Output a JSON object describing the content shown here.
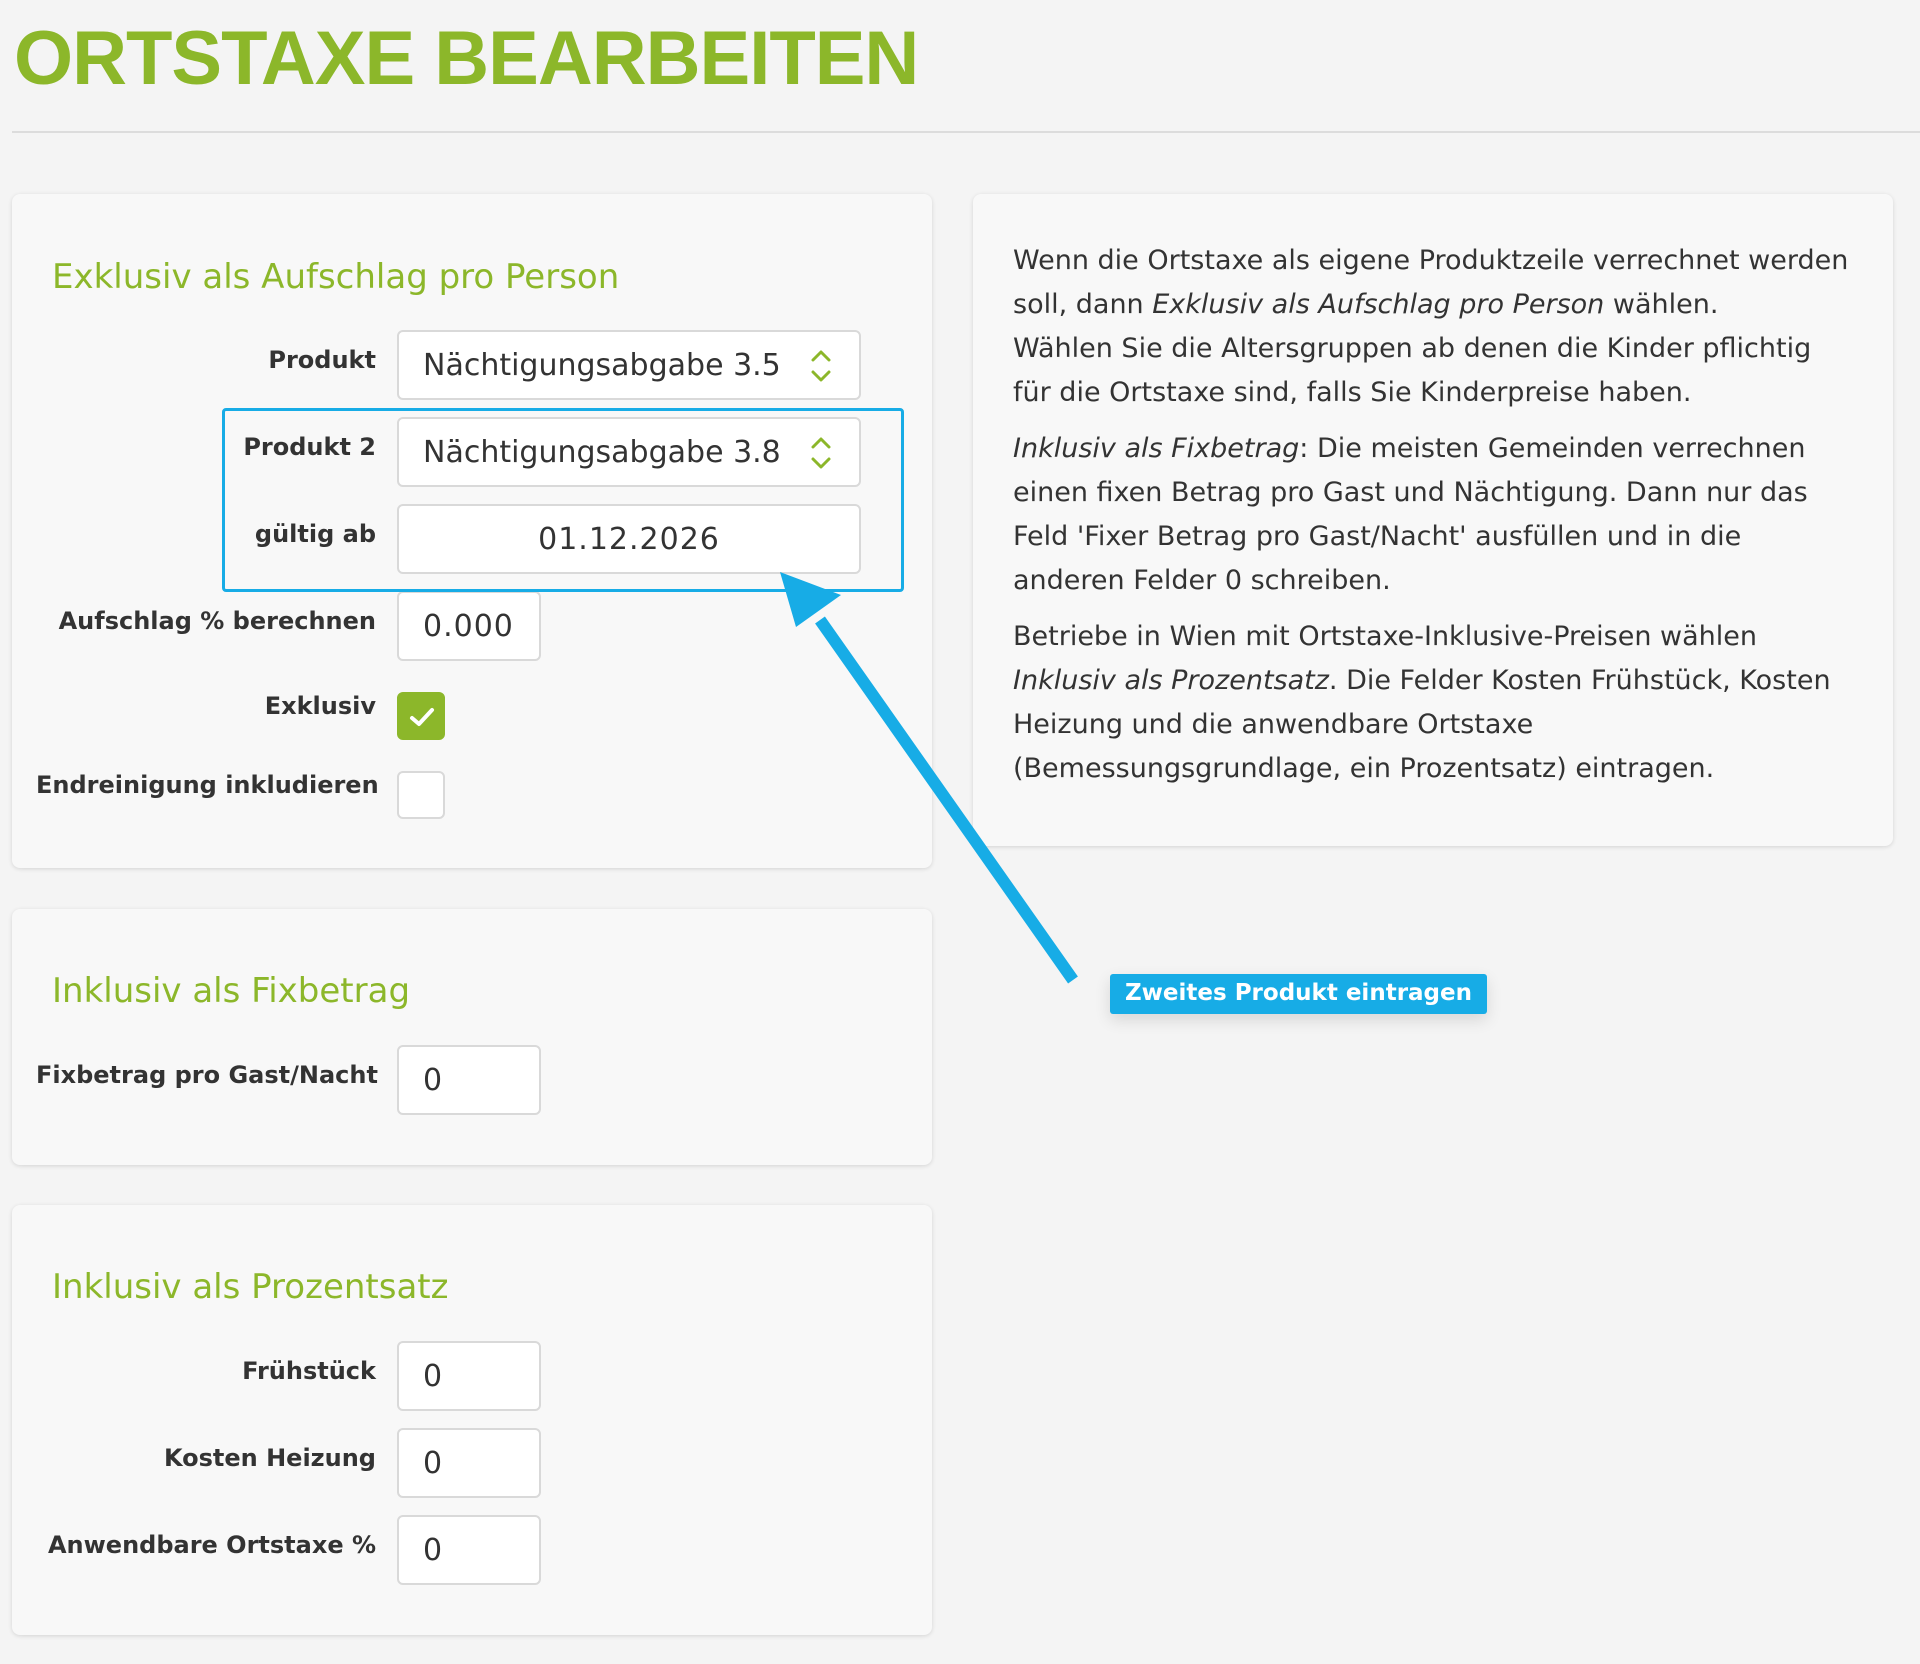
{
  "page": {
    "title": "ORTSTAXE BEARBEITEN"
  },
  "colors": {
    "accent": "#8cb72a",
    "highlight": "#17ace6"
  },
  "exklusiv": {
    "title": "Exklusiv als Aufschlag pro Person",
    "produkt": {
      "label": "Produkt",
      "value": "Nächtigungsabgabe 3.5"
    },
    "produkt2": {
      "label": "Produkt 2",
      "value": "Nächtigungsabgabe 3.8"
    },
    "gueltig_ab": {
      "label": "gültig ab",
      "value": "01.12.2026"
    },
    "aufschlag": {
      "label": "Aufschlag % berechnen",
      "value": "0.000"
    },
    "exklusiv_check": {
      "label": "Exklusiv",
      "checked": true
    },
    "endreinigung": {
      "label": "Endreinigung inkludieren",
      "checked": false
    }
  },
  "fixbetrag": {
    "title": "Inklusiv als Fixbetrag",
    "fix": {
      "label": "Fixbetrag pro Gast/Nacht",
      "value": "0"
    }
  },
  "prozentsatz": {
    "title": "Inklusiv als Prozentsatz",
    "fruehstueck": {
      "label": "Frühstück",
      "value": "0"
    },
    "heizung": {
      "label": "Kosten Heizung",
      "value": "0"
    },
    "ortstaxe": {
      "label": "Anwendbare Ortstaxe %",
      "value": "0"
    }
  },
  "info": {
    "p1a": "Wenn die Ortstaxe als eigene Produktzeile verrechnet werden soll, dann ",
    "p1b": "Exklusiv als Aufschlag pro Person",
    "p1c": " wählen.",
    "p1d": "Wählen Sie die Altersgruppen ab denen die Kinder pflichtig für die Ortstaxe sind, falls Sie Kinderpreise haben.",
    "p2a": "Inklusiv als Fixbetrag",
    "p2b": ": Die meisten Gemeinden verrechnen einen fixen Betrag pro Gast und Nächtigung. Dann nur das Feld 'Fixer Betrag pro Gast/Nacht' ausfüllen und in die anderen Felder 0 schreiben.",
    "p3a": "Betriebe in Wien mit Ortstaxe-Inklusive-Preisen wählen ",
    "p3b": "Inklusiv als Prozentsatz",
    "p3c": ". Die Felder Kosten Frühstück, Kosten Heizung und die anwendbare Ortstaxe (Bemessungsgrundlage, ein Prozentsatz) eintragen."
  },
  "annotation": {
    "tooltip": "Zweites Produkt eintragen",
    "icon": "pointer-arrow-icon"
  }
}
